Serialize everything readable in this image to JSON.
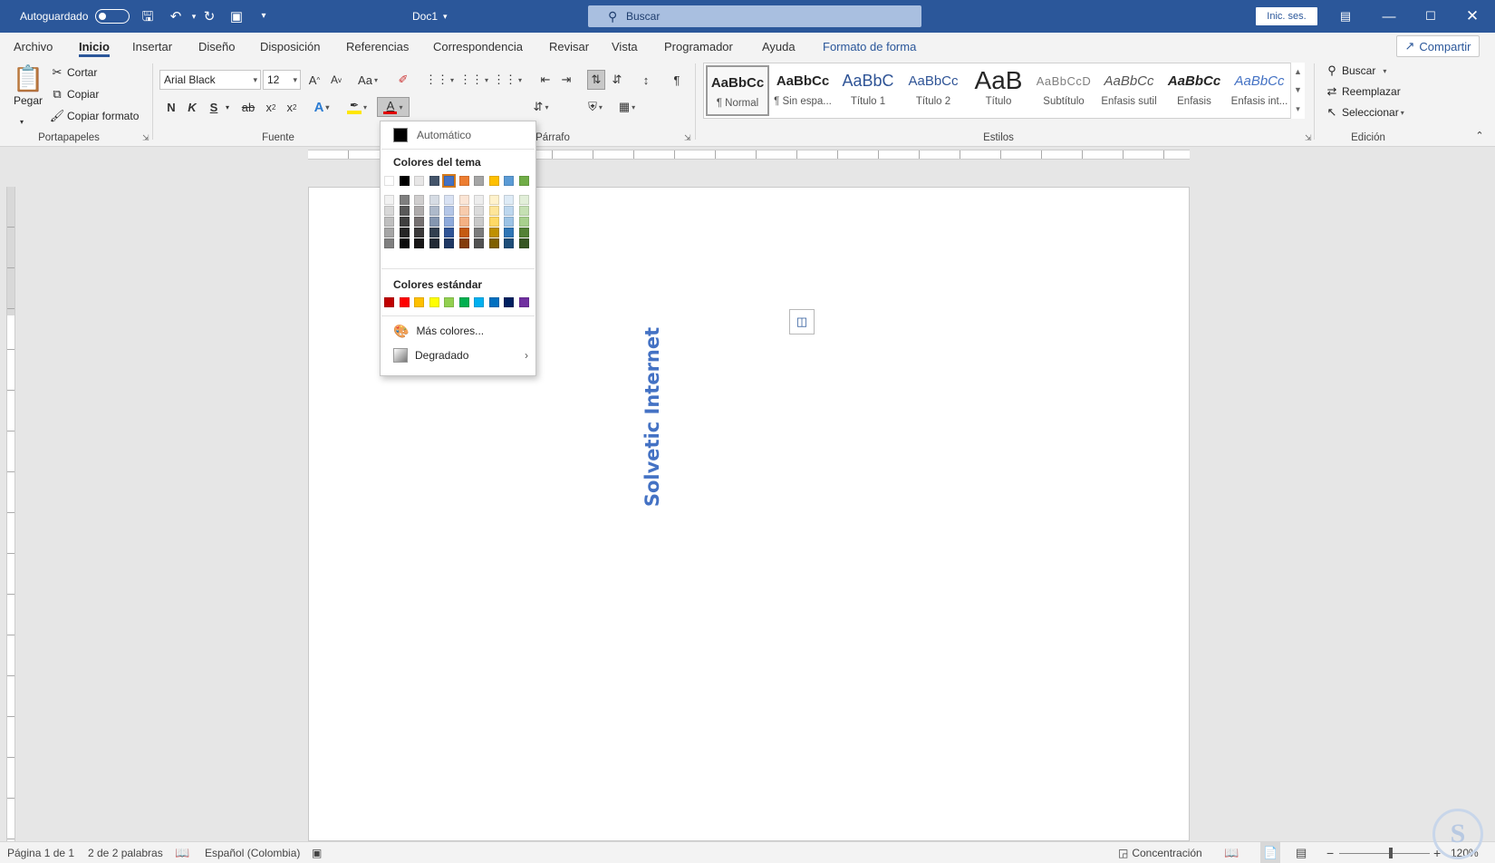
{
  "titlebar": {
    "autosave_label": "Autoguardado",
    "doc_name": "Doc1",
    "search_placeholder": "Buscar",
    "signin_label": "Inic. ses."
  },
  "tabs": [
    "Archivo",
    "Inicio",
    "Insertar",
    "Diseño",
    "Disposición",
    "Referencias",
    "Correspondencia",
    "Revisar",
    "Vista",
    "Programador",
    "Ayuda",
    "Formato de forma"
  ],
  "active_tab": "Inicio",
  "share_label": "Compartir",
  "clipboard": {
    "paste_label": "Pegar",
    "cut_label": "Cortar",
    "copy_label": "Copiar",
    "format_painter_label": "Copiar formato",
    "group_label": "Portapapeles"
  },
  "font": {
    "font_name": "Arial Black",
    "font_size": "12",
    "bold_label": "N",
    "italic_label": "K",
    "underline_label": "S",
    "group_label": "Fuente",
    "change_case_label": "Aa",
    "grow_label": "A",
    "shrink_label": "A",
    "font_color_letter": "A",
    "highlight_color": "#ffe600",
    "font_color": "#e00000"
  },
  "paragraph": {
    "group_label": "Párrafo"
  },
  "styles": {
    "group_label": "Estilos",
    "items": [
      {
        "sample": "AaBbCc",
        "name": "¶ Normal"
      },
      {
        "sample": "AaBbCc",
        "name": "¶ Sin espa..."
      },
      {
        "sample": "AaBbC",
        "name": "Título 1"
      },
      {
        "sample": "AaBbCc",
        "name": "Título 2"
      },
      {
        "sample": "AaB",
        "name": "Título"
      },
      {
        "sample": "AaBbCcD",
        "name": "Subtítulo"
      },
      {
        "sample": "AaBbCc",
        "name": "Énfasis sutil"
      },
      {
        "sample": "AaBbCc",
        "name": "Énfasis"
      },
      {
        "sample": "AaBbCc",
        "name": "Énfasis int..."
      }
    ]
  },
  "editing": {
    "group_label": "Edición",
    "find_label": "Buscar",
    "replace_label": "Reemplazar",
    "select_label": "Seleccionar"
  },
  "document": {
    "wordart_text": "Solvetic Internet"
  },
  "color_menu": {
    "automatic_label": "Automático",
    "theme_colors_label": "Colores del tema",
    "theme_colors": [
      "#ffffff",
      "#000000",
      "#e7e6e6",
      "#44546a",
      "#4472c4",
      "#ed7d31",
      "#a5a5a5",
      "#ffc000",
      "#5b9bd5",
      "#70ad47"
    ],
    "theme_tints": [
      [
        "#f2f2f2",
        "#7f7f7f",
        "#d0cece",
        "#d6dce4",
        "#d9e2f3",
        "#fbe5d5",
        "#ededed",
        "#fff2cc",
        "#deebf6",
        "#e2efd9"
      ],
      [
        "#d8d8d8",
        "#595959",
        "#aeabab",
        "#adb9ca",
        "#b4c6e7",
        "#f7cbac",
        "#dbdbdb",
        "#fee599",
        "#bdd7ee",
        "#c5e0b3"
      ],
      [
        "#bfbfbf",
        "#3f3f3f",
        "#757070",
        "#8496b0",
        "#8eaadb",
        "#f4b183",
        "#c9c9c9",
        "#ffd965",
        "#9cc3e5",
        "#a8d08d"
      ],
      [
        "#a5a5a5",
        "#262626",
        "#3a3838",
        "#323f4f",
        "#2f5496",
        "#c55a11",
        "#7b7b7b",
        "#bf9000",
        "#2e75b5",
        "#538135"
      ],
      [
        "#7f7f7f",
        "#0c0c0c",
        "#171616",
        "#222a35",
        "#1f3864",
        "#833c0b",
        "#525252",
        "#7f6000",
        "#1e4e79",
        "#375623"
      ]
    ],
    "standard_colors_label": "Colores estándar",
    "standard_colors": [
      "#c00000",
      "#ff0000",
      "#ffc000",
      "#ffff00",
      "#92d050",
      "#00b050",
      "#00b0f0",
      "#0070c0",
      "#002060",
      "#7030a0"
    ],
    "more_colors_label": "Más colores...",
    "gradient_label": "Degradado"
  },
  "statusbar": {
    "page_label": "Página 1 de 1",
    "words_label": "2 de 2 palabras",
    "language_label": "Español (Colombia)",
    "focus_label": "Concentración",
    "zoom_label": "120%"
  }
}
